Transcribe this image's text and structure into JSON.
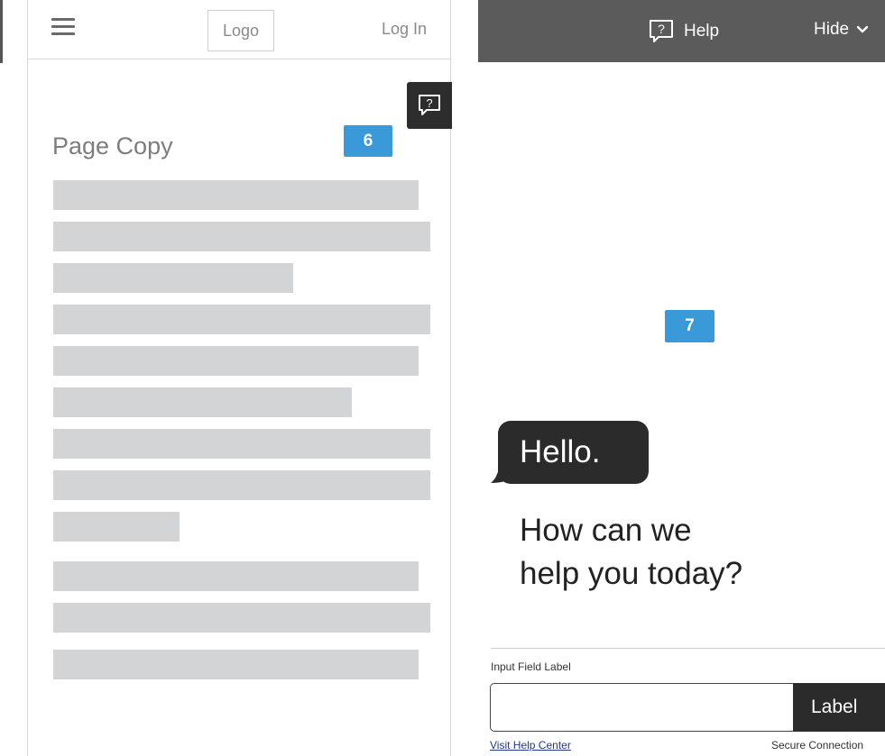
{
  "left_panel": {
    "header": {
      "logo_label": "Logo",
      "login_label": "Log In"
    },
    "page_copy_title": "Page Copy",
    "callout_number": "6"
  },
  "right_panel": {
    "header": {
      "help_label": "Help",
      "hide_label": "Hide"
    },
    "callout_number": "7",
    "greeting": "Hello.",
    "question_line1": "How can we",
    "question_line2": "help you today?",
    "input_field_label": "Input Field Label",
    "input_value": "",
    "submit_label": "Label",
    "visit_help_link": "Visit Help Center",
    "secure_connection": "Secure Connection"
  },
  "icons": {
    "menu": "hamburger-icon",
    "help": "help-chat-icon",
    "hide": "chevron-down-icon"
  },
  "colors": {
    "header_bg": "#5b5b5b",
    "dark": "#2b2b2b",
    "badge": "#3a9ad9",
    "placeholder_bar": "#d3d4d6",
    "link": "#1f3a8a"
  }
}
